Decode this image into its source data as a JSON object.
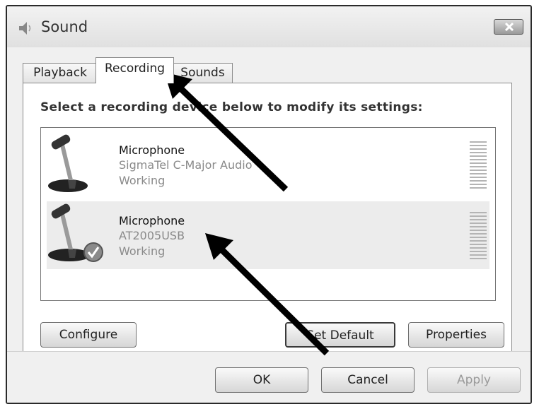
{
  "window": {
    "title": "Sound",
    "icon": "speaker-icon",
    "close_icon": "close-icon"
  },
  "tabs": [
    {
      "label": "Playback",
      "active": false
    },
    {
      "label": "Recording",
      "active": true
    },
    {
      "label": "Sounds",
      "active": false
    }
  ],
  "instructions": "Select a recording device below to modify its settings:",
  "devices": [
    {
      "name": "Microphone",
      "description": "SigmaTel C-Major Audio",
      "status": "Working",
      "icon": "microphone-icon",
      "is_default": false,
      "selected": false
    },
    {
      "name": "Microphone",
      "description": "AT2005USB",
      "status": "Working",
      "icon": "microphone-default-icon",
      "is_default": true,
      "selected": true
    }
  ],
  "buttons": {
    "configure": "Configure",
    "set_default": "Set Default",
    "properties": "Properties",
    "ok": "OK",
    "cancel": "Cancel",
    "apply": "Apply"
  },
  "colors": {
    "arrow": "#000000",
    "selected_row": "#ececec"
  }
}
